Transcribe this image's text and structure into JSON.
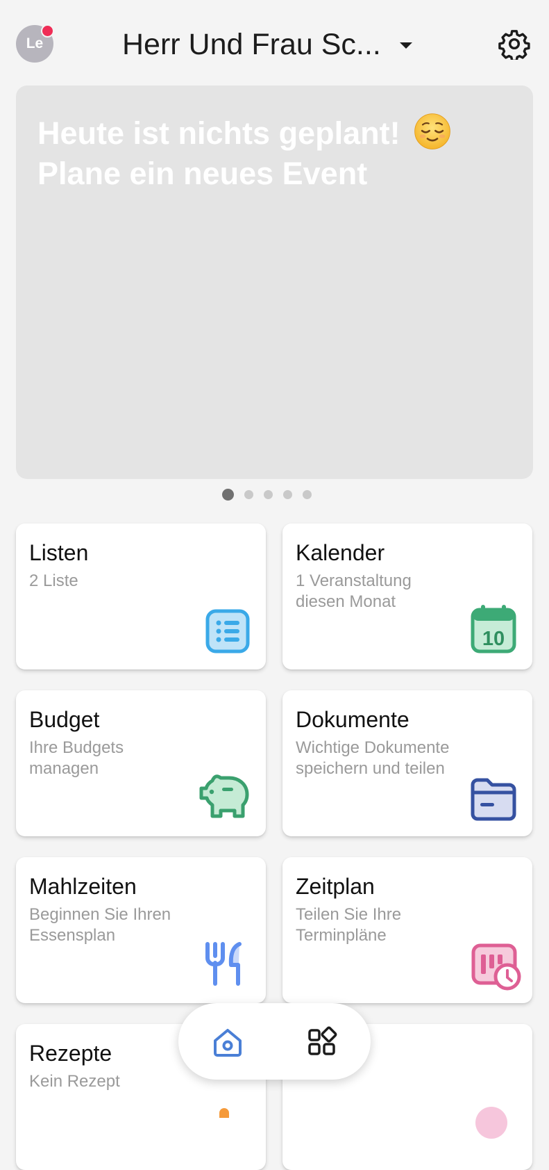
{
  "header": {
    "avatar_initials": "Le",
    "title": "Herr Und Frau Sc...",
    "icons": {
      "dropdown": "caret-down-icon",
      "settings": "gear-icon"
    }
  },
  "banner": {
    "line1": "Heute ist nichts geplant!",
    "line2": "Plane ein neues Event",
    "emoji": "relieved-face-emoji"
  },
  "carousel": {
    "pages": 5,
    "active_page": 1
  },
  "cards": {
    "listen": {
      "title": "Listen",
      "subtitle": "2 Liste",
      "icon": "list-icon",
      "color": "#3aa9e8"
    },
    "kalender": {
      "title": "Kalender",
      "subtitle": "1 Veranstaltung diesen Monat",
      "icon": "calendar-icon",
      "icon_text": "10",
      "color": "#3daa76"
    },
    "budget": {
      "title": "Budget",
      "subtitle": "Ihre Budgets managen",
      "icon": "piggy-bank-icon",
      "color": "#3aa06e"
    },
    "dokumente": {
      "title": "Dokumente",
      "subtitle": "Wichtige Dokumente speichern und teilen",
      "icon": "folder-icon",
      "color": "#3551a1"
    },
    "mahlzeiten": {
      "title": "Mahlzeiten",
      "subtitle": "Beginnen Sie Ihren Essensplan",
      "icon": "cutlery-icon",
      "color": "#5f8fef"
    },
    "zeitplan": {
      "title": "Zeitplan",
      "subtitle": "Teilen Sie Ihre Terminpläne",
      "icon": "schedule-clock-icon",
      "color": "#de5f94"
    },
    "rezepte": {
      "title": "Rezepte",
      "subtitle": "Kein Rezept"
    }
  },
  "bottom_nav": {
    "items": [
      {
        "icon": "home-icon",
        "active": true,
        "color": "#4a7fd6"
      },
      {
        "icon": "apps-grid-icon",
        "active": false,
        "color": "#1b1b1b"
      }
    ]
  }
}
